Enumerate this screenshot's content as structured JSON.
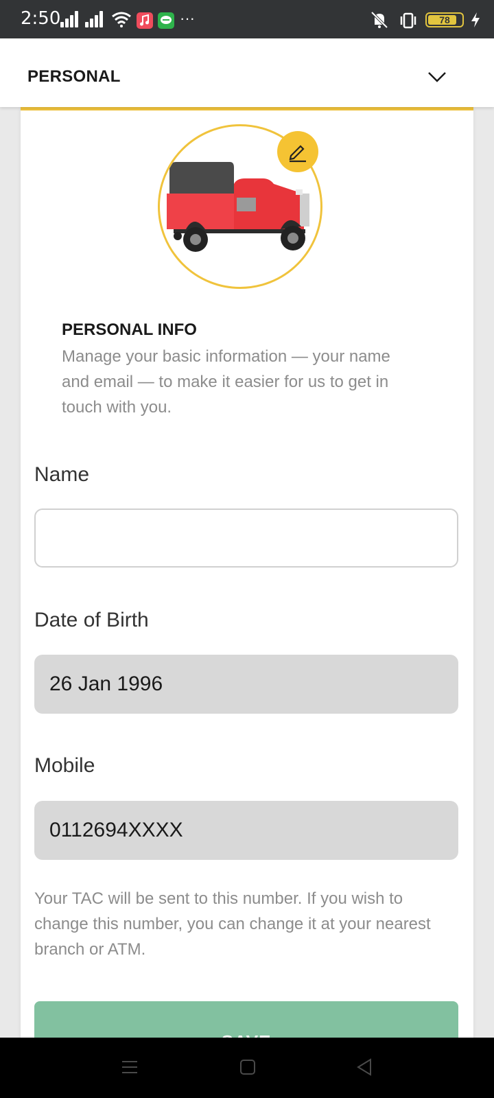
{
  "status_bar": {
    "time": "2:50",
    "battery": "78",
    "more": "···",
    "icons": [
      "signal-icon",
      "signal-icon",
      "wifi-icon",
      "music-app-icon",
      "line-app-icon",
      "mute-icon",
      "vibrate-icon",
      "battery-icon",
      "charging-icon"
    ]
  },
  "header": {
    "title": "PERSONAL",
    "toggle_icon": "chevron-down-icon"
  },
  "profile": {
    "edit_icon": "pencil-icon"
  },
  "info": {
    "title": "PERSONAL INFO",
    "description": "Manage your basic information — your name and email — to make it easier for us to get in touch with you."
  },
  "form": {
    "name_label": "Name",
    "name_value": "",
    "dob_label": "Date of Birth",
    "dob_value": "26 Jan 1996",
    "mobile_label": "Mobile",
    "mobile_value": "0112694XXXX",
    "tac_note": "Your TAC will be sent to this number. If you wish to change this number, you can change it at your nearest branch or ATM.",
    "save_label": "SAVE"
  },
  "colors": {
    "accent": "#f0c33c",
    "save_button": "#82c1a0",
    "disabled_field": "#d8d8d8"
  },
  "nav_bar": {
    "icons": [
      "menu-icon",
      "home-icon",
      "back-icon"
    ]
  }
}
